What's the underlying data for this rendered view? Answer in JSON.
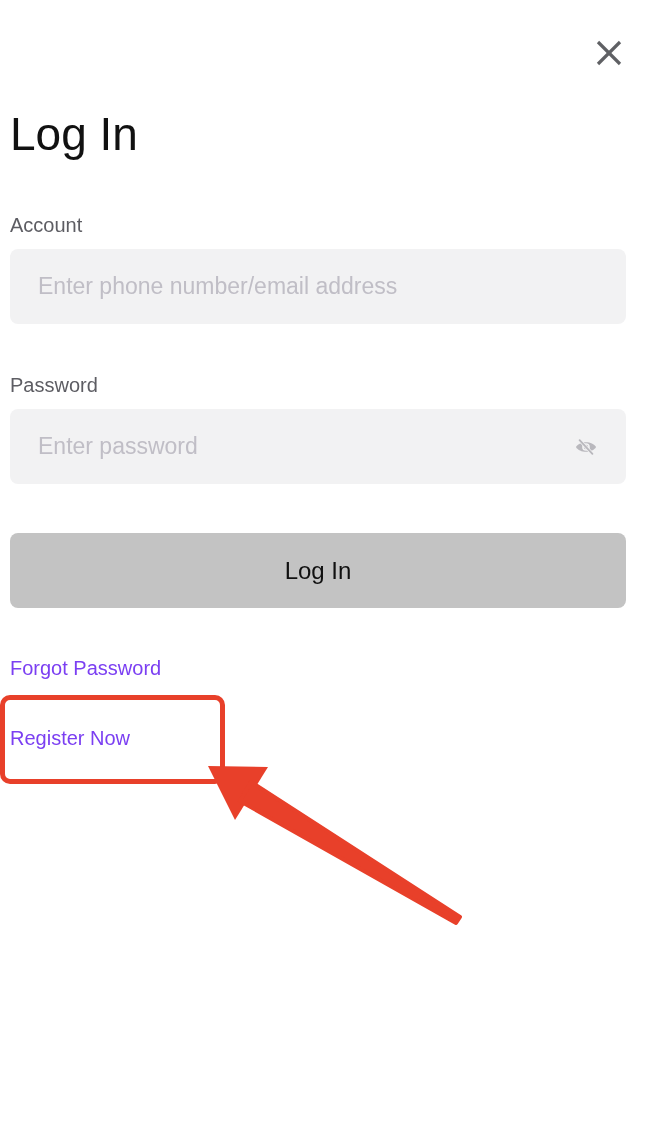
{
  "title": "Log In",
  "fields": [
    {
      "kind": "text",
      "label": "Account",
      "placeholder": "Enter phone number/email address"
    },
    {
      "kind": "password",
      "label": "Password",
      "placeholder": "Enter password",
      "password_visible": false
    }
  ],
  "login_button": {
    "label": "Log In",
    "disabled": true
  },
  "links": [
    {
      "label": "Forgot Password",
      "highlighted": false
    },
    {
      "label": "Register Now",
      "highlighted": true
    }
  ]
}
